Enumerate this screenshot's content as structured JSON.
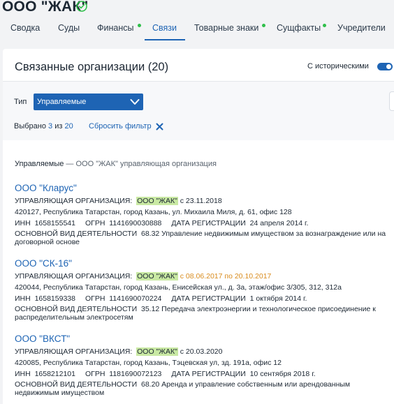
{
  "company": {
    "title": "ООО \"ЖАК\"",
    "verified_icon": "check-circle-icon"
  },
  "tabs": [
    {
      "label": "Сводка",
      "dot": false
    },
    {
      "label": "Суды",
      "dot": false
    },
    {
      "label": "Финансы",
      "dot": true
    },
    {
      "label": "Связи",
      "dot": false,
      "active": true
    },
    {
      "label": "Товарные знаки",
      "dot": true
    },
    {
      "label": "Сущфакты",
      "dot": true
    },
    {
      "label": "Учредители",
      "dot": false
    }
  ],
  "card": {
    "title": "Связанные организации (20)",
    "historical_label": "С историческими",
    "historical_enabled": true
  },
  "filter": {
    "type_label": "Тип",
    "type_value": "Управляемые",
    "selected_prefix": "Выбрано",
    "selected_count": "3",
    "selected_of": "из",
    "selected_total": "20",
    "reset_label": "Сбросить фильтр"
  },
  "section": {
    "name": "Управляемые",
    "description": " — ООО \"ЖАК\" управляющая организация"
  },
  "labels": {
    "mgmt": "УПРАВЛЯЮЩАЯ ОРГАНИЗАЦИЯ:",
    "inn": "ИНН",
    "ogrn": "ОГРН",
    "reg_date": "ДАТА РЕГИСТРАЦИИ",
    "activity": "ОСНОВНОЙ ВИД ДЕЯТЕЛЬНОСТИ"
  },
  "organizations": [
    {
      "name": "ООО \"Кларус\"",
      "manager": "ООО \"ЖАК\"",
      "manager_period": "с 23.11.2018",
      "address": "420127, Республика Татарстан, город Казань, ул. Михаила Миля, д. 61, офис 128",
      "inn": "1658155541",
      "ogrn": "1141690030888",
      "reg_date": "24 апреля 2014 г.",
      "activity": "68.32 Управление недвижимым имуществом за вознаграждение или на договорной основе"
    },
    {
      "name": "ООО \"СК-16\"",
      "manager": "ООО \"ЖАК\"",
      "manager_period": "с 08.06.2017 по 20.10.2017",
      "address": "420044, Республика Татарстан, город Казань, Енисейская ул., д. 3а, этаж/офис 3/305, 312, 312а",
      "inn": "1658159338",
      "ogrn": "1141690070224",
      "reg_date": "1 октября 2014 г.",
      "activity": "35.12 Передача электроэнергии и технологическое присоединение к распределительным электросетям"
    },
    {
      "name": "ООО \"ВКСТ\"",
      "manager": "ООО \"ЖАК\"",
      "manager_period": "с 20.03.2020",
      "address": "420085, Республика Татарстан, город Казань, Тэцевская ул, зд. 191а, офис 12",
      "inn": "1658212101",
      "ogrn": "1181690072123",
      "reg_date": "10 сентября 2018 г.",
      "activity": "68.20 Аренда и управление собственным или арендованным недвижимым имуществом"
    }
  ],
  "colors": {
    "accent": "#1e64b4",
    "highlight": "#c9e9a3",
    "history": "#d98c1e",
    "dot": "#2fbf4a"
  }
}
